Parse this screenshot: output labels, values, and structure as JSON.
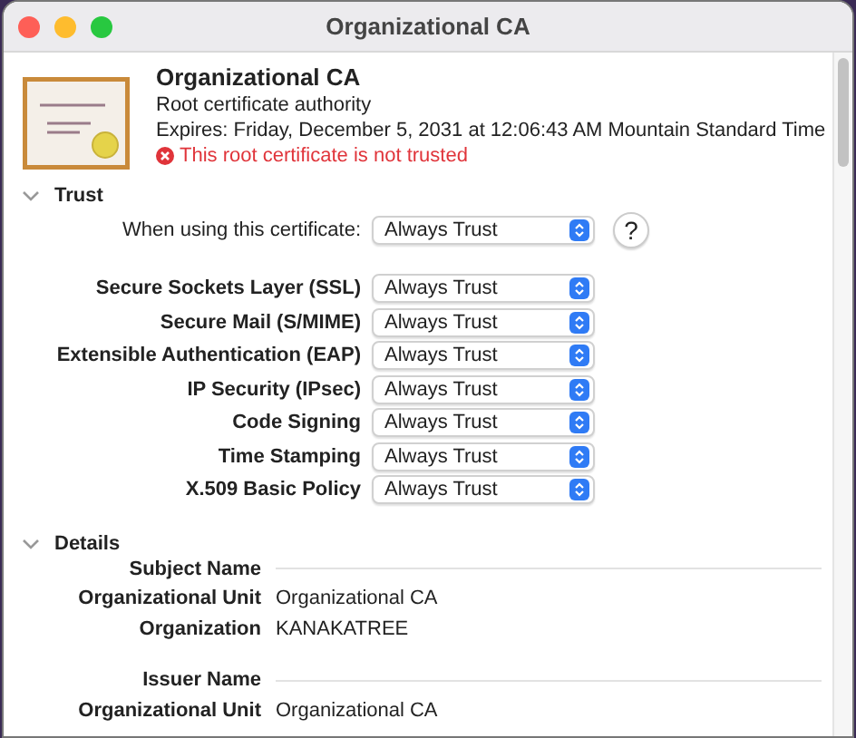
{
  "window": {
    "title": "Organizational CA"
  },
  "certificate": {
    "name": "Organizational CA",
    "type": "Root certificate authority",
    "expires": "Expires: Friday, December 5, 2031 at 12:06:43 AM Mountain Standard Time",
    "warning": "This root certificate is not trusted"
  },
  "trust": {
    "title": "Trust",
    "expanded": true,
    "default_row": {
      "label": "When using this certificate:",
      "value": "Always Trust"
    },
    "help": "?",
    "policies": [
      {
        "label": "Secure Sockets Layer (SSL)",
        "value": "Always Trust"
      },
      {
        "label": "Secure Mail (S/MIME)",
        "value": "Always Trust"
      },
      {
        "label": "Extensible Authentication (EAP)",
        "value": "Always Trust"
      },
      {
        "label": "IP Security (IPsec)",
        "value": "Always Trust"
      },
      {
        "label": "Code Signing",
        "value": "Always Trust"
      },
      {
        "label": "Time Stamping",
        "value": "Always Trust"
      },
      {
        "label": "X.509 Basic Policy",
        "value": "Always Trust"
      }
    ]
  },
  "details": {
    "title": "Details",
    "expanded": true,
    "groups": [
      {
        "heading": "Subject Name",
        "fields": [
          {
            "label": "Organizational Unit",
            "value": "Organizational CA"
          },
          {
            "label": "Organization",
            "value": "KANAKATREE"
          }
        ]
      },
      {
        "heading": "Issuer Name",
        "fields": [
          {
            "label": "Organizational Unit",
            "value": "Organizational CA"
          }
        ]
      }
    ]
  }
}
